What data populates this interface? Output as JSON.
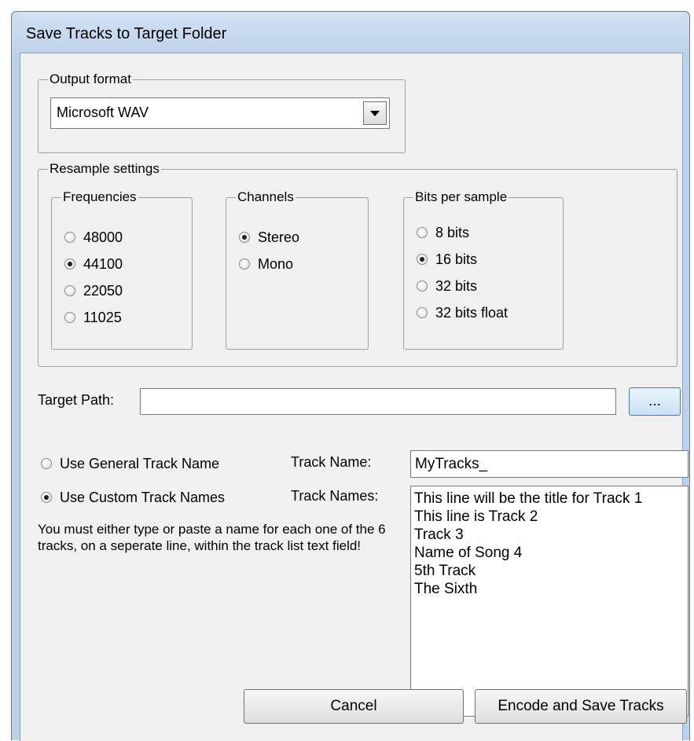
{
  "window": {
    "title": "Save Tracks to Target Folder"
  },
  "output_format": {
    "legend": "Output format",
    "selected": "Microsoft WAV"
  },
  "resample": {
    "legend": "Resample settings",
    "frequencies": {
      "legend": "Frequencies",
      "options": [
        "48000",
        "44100",
        "22050",
        "11025"
      ],
      "selected": "44100"
    },
    "channels": {
      "legend": "Channels",
      "options": [
        "Stereo",
        "Mono"
      ],
      "selected": "Stereo"
    },
    "bits": {
      "legend": "Bits per sample",
      "options": [
        "8 bits",
        "16 bits",
        "32 bits",
        "32 bits float"
      ],
      "selected": "16 bits"
    }
  },
  "target": {
    "label": "Target Path:",
    "value": "",
    "browse_label": "..."
  },
  "naming": {
    "general_label": "Use General Track Name",
    "custom_label": "Use Custom Track Names",
    "selected": "custom",
    "track_name_label": "Track Name:",
    "track_name_value": "MyTracks_",
    "track_names_label": "Track Names:",
    "track_names": [
      "This line will be the title for Track 1",
      "This line is Track 2",
      "Track 3",
      "Name of Song 4",
      "5th Track",
      "The Sixth"
    ],
    "hint": "You must either type or paste a name for each one of the 6 tracks, on a seperate line, within the track list text field!"
  },
  "buttons": {
    "cancel": "Cancel",
    "encode": "Encode and Save Tracks"
  }
}
